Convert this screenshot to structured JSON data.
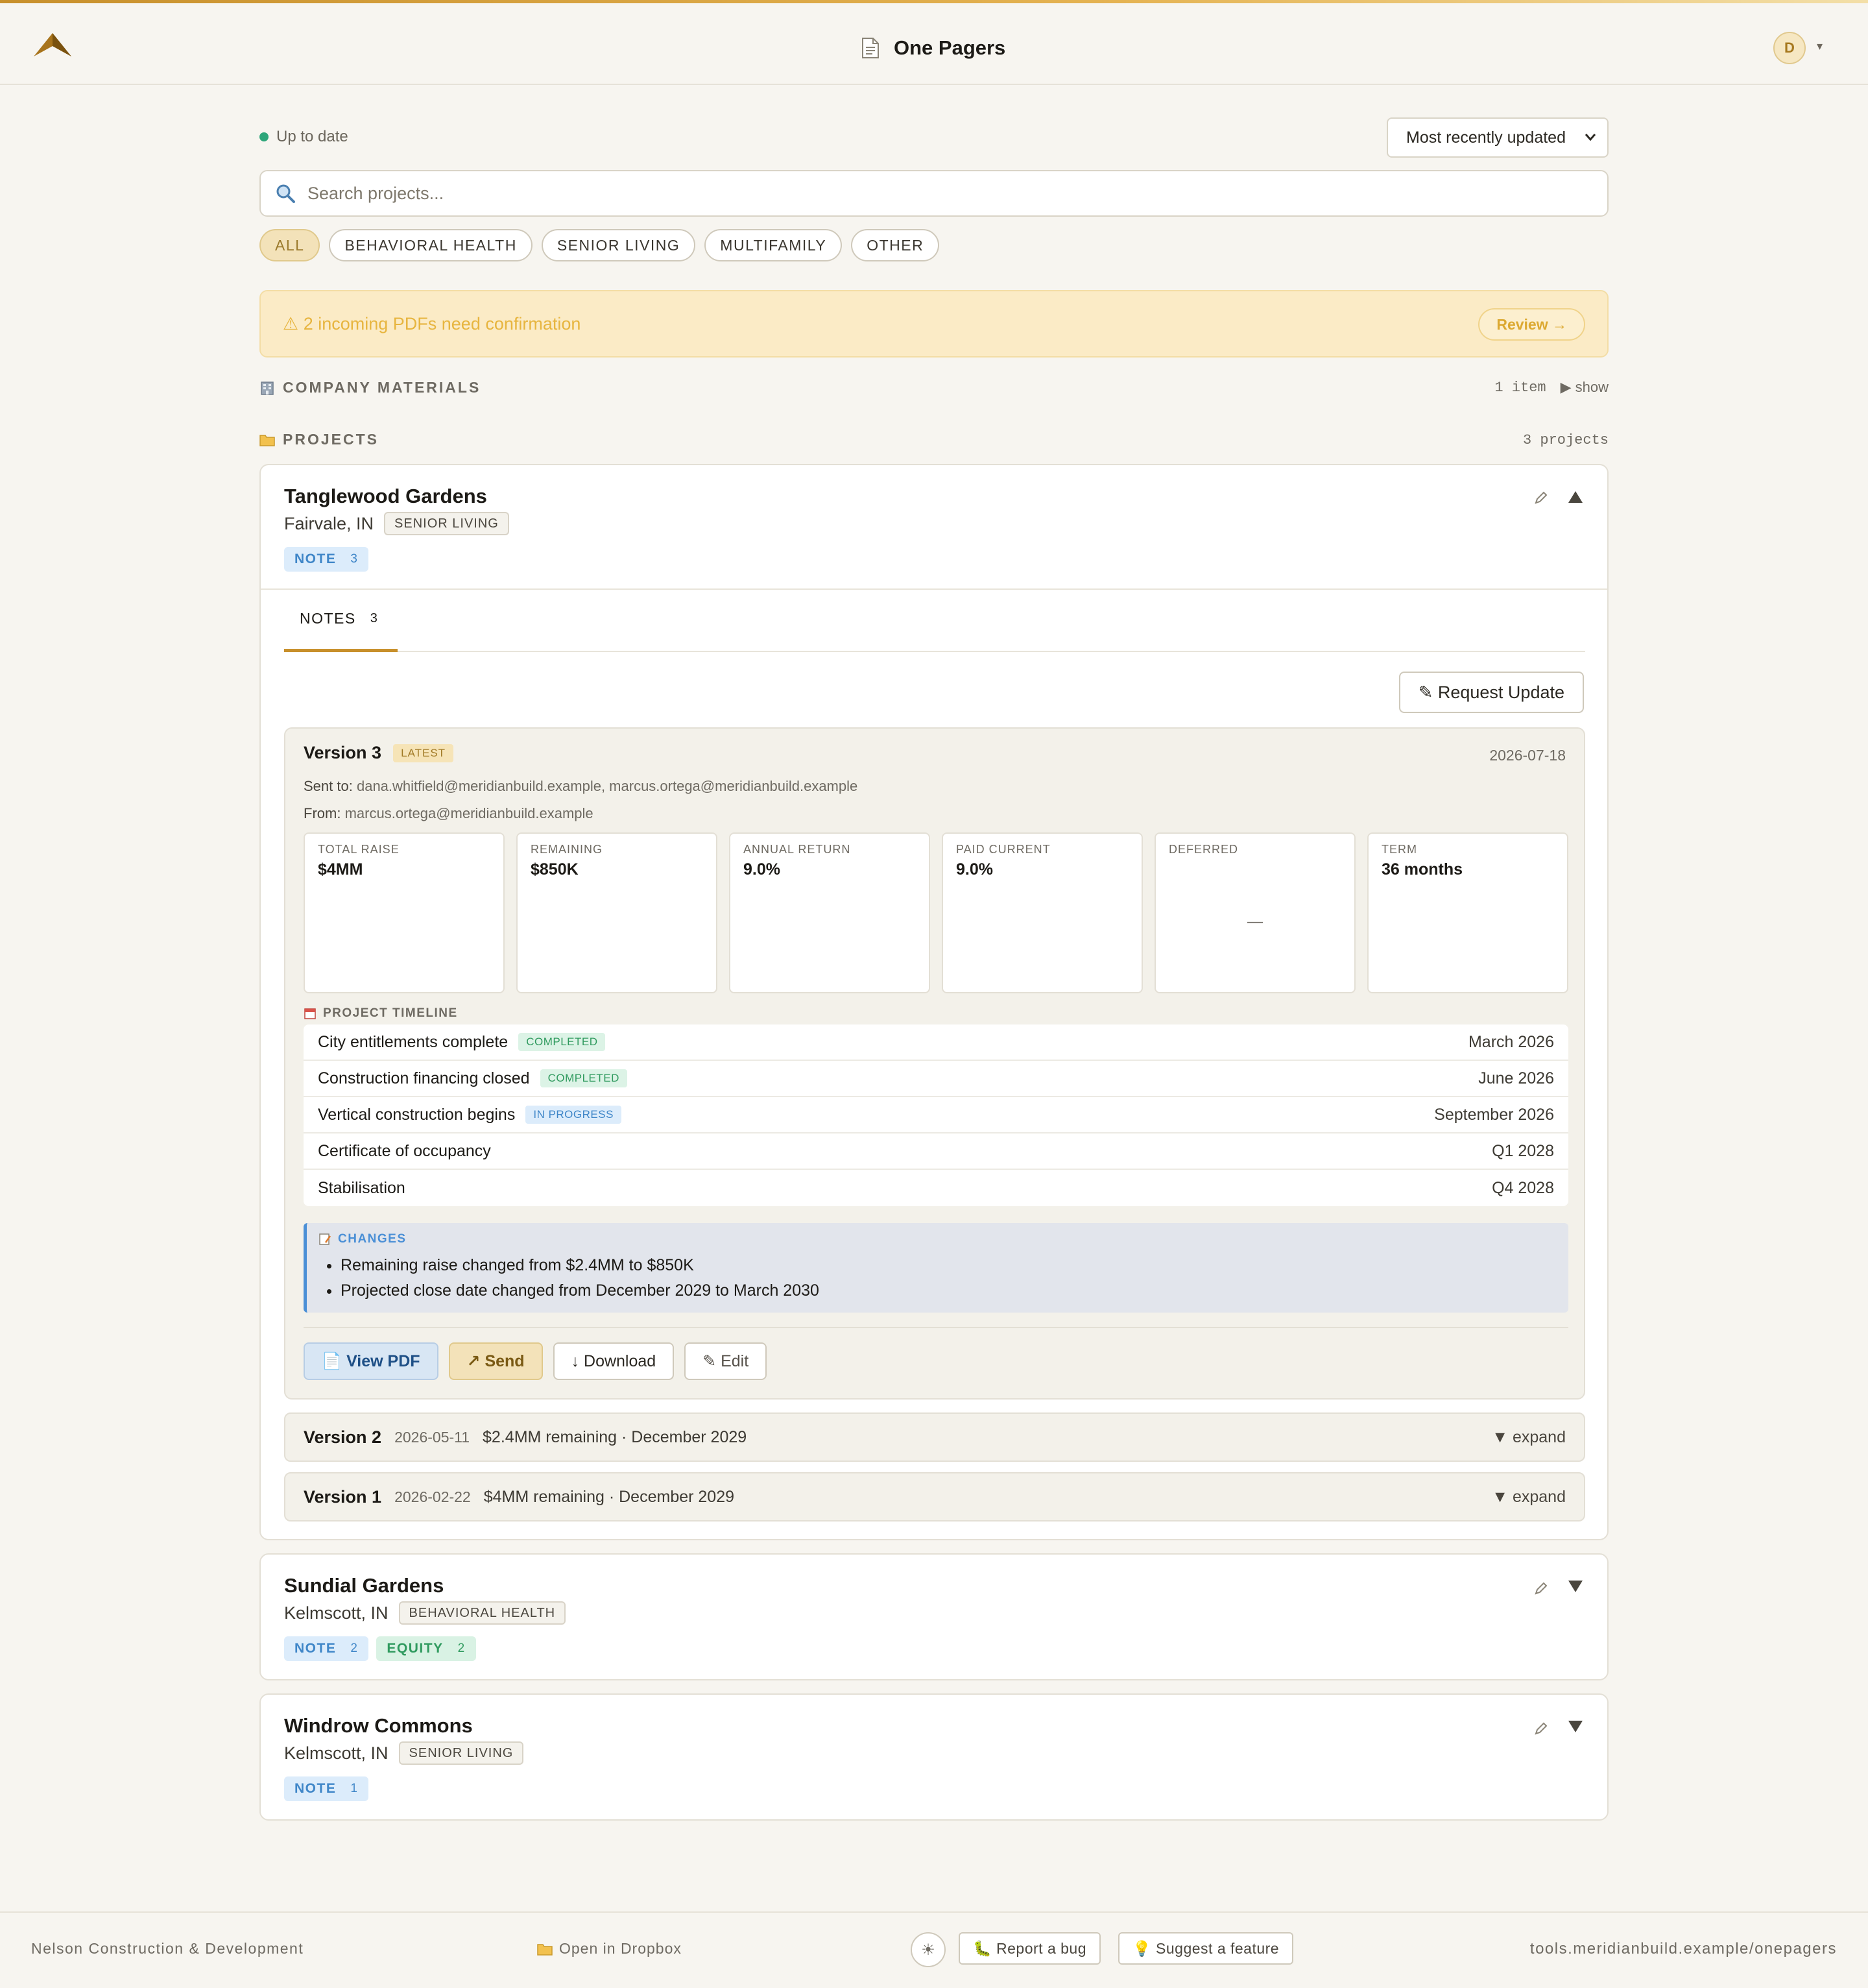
{
  "header": {
    "title": "One Pagers",
    "avatar_initial": "D",
    "avatar_caret": "▾",
    "logo_icon": "mountain-logo",
    "title_icon": "document-icon"
  },
  "status": {
    "text": "Up to date"
  },
  "sort": {
    "selected": "Most recently updated"
  },
  "search": {
    "placeholder": "Search projects..."
  },
  "filters": [
    {
      "label": "ALL",
      "active": true
    },
    {
      "label": "BEHAVIORAL HEALTH",
      "active": false
    },
    {
      "label": "SENIOR LIVING",
      "active": false
    },
    {
      "label": "MULTIFAMILY",
      "active": false
    },
    {
      "label": "OTHER",
      "active": false
    }
  ],
  "banner": {
    "message": "⚠ 2 incoming PDFs need confirmation",
    "action": "Review →"
  },
  "company_materials": {
    "heading": "COMPANY MATERIALS",
    "count": "1 item",
    "toggle": "▶ show"
  },
  "projects_section": {
    "heading": "PROJECTS",
    "count": "3 projects"
  },
  "projects": [
    {
      "name": "Tanglewood Gardens",
      "location": "Fairvale, IN",
      "tag": "SENIOR LIVING",
      "chips": [
        {
          "label": "NOTE",
          "count": "3"
        }
      ],
      "expanded": true,
      "tab": {
        "label": "NOTES",
        "count": "3"
      },
      "request_update": "✎ Request Update",
      "latest_version": {
        "title": "Version 3",
        "badge": "LATEST",
        "date": "2026-07-18",
        "sent_to_label": "Sent to:",
        "sent_to": "dana.whitfield@meridianbuild.example, marcus.ortega@meridianbuild.example",
        "from_label": "From:",
        "from": "marcus.ortega@meridianbuild.example",
        "metrics": [
          {
            "label": "TOTAL RAISE",
            "value": "$4MM"
          },
          {
            "label": "REMAINING",
            "value": "$850K"
          },
          {
            "label": "ANNUAL RETURN",
            "value": "9.0%"
          },
          {
            "label": "PAID CURRENT",
            "value": "9.0%"
          },
          {
            "label": "DEFERRED",
            "value": "—"
          },
          {
            "label": "TERM",
            "value": "36 months"
          }
        ],
        "timeline_heading": "PROJECT TIMELINE",
        "timeline": [
          {
            "task": "City entitlements complete",
            "status": "COMPLETED",
            "date": "March 2026"
          },
          {
            "task": "Construction financing closed",
            "status": "COMPLETED",
            "date": "June 2026"
          },
          {
            "task": "Vertical construction begins",
            "status": "IN PROGRESS",
            "date": "September 2026"
          },
          {
            "task": "Certificate of occupancy",
            "status": "",
            "date": "Q1 2028"
          },
          {
            "task": "Stabilisation",
            "status": "",
            "date": "Q4 2028"
          }
        ],
        "changes_heading": "CHANGES",
        "changes": [
          "Remaining raise changed from $2.4MM to $850K",
          "Projected close date changed from December 2029 to March 2030"
        ],
        "actions": {
          "view_pdf": "📄 View PDF",
          "send": "↗ Send",
          "download": "↓ Download",
          "edit": "✎ Edit"
        }
      },
      "older_versions": [
        {
          "title": "Version 2",
          "date": "2026-05-11",
          "summary": "$2.4MM remaining · December 2029",
          "toggle": "▼ expand"
        },
        {
          "title": "Version 1",
          "date": "2026-02-22",
          "summary": "$4MM remaining · December 2029",
          "toggle": "▼ expand"
        }
      ]
    },
    {
      "name": "Sundial Gardens",
      "location": "Kelmscott, IN",
      "tag": "BEHAVIORAL HEALTH",
      "chips": [
        {
          "label": "NOTE",
          "count": "2"
        },
        {
          "label": "EQUITY",
          "count": "2"
        }
      ],
      "expanded": false
    },
    {
      "name": "Windrow Commons",
      "location": "Kelmscott, IN",
      "tag": "SENIOR LIVING",
      "chips": [
        {
          "label": "NOTE",
          "count": "1"
        }
      ],
      "expanded": false
    }
  ],
  "footer": {
    "company": "Nelson Construction & Development",
    "dropbox": "Open in Dropbox",
    "theme_icon": "☀",
    "report_bug": "🐛 Report a bug",
    "suggest": "💡 Suggest a feature",
    "url": "tools.meridianbuild.example/onepagers"
  },
  "colors": {
    "accent": "#c8902c",
    "background": "#f7f5f0",
    "status_ok": "#2ea67a",
    "note_blue": "#3f86c8",
    "equity_green": "#2f9a5e",
    "banner_bg": "#fbebc6"
  }
}
